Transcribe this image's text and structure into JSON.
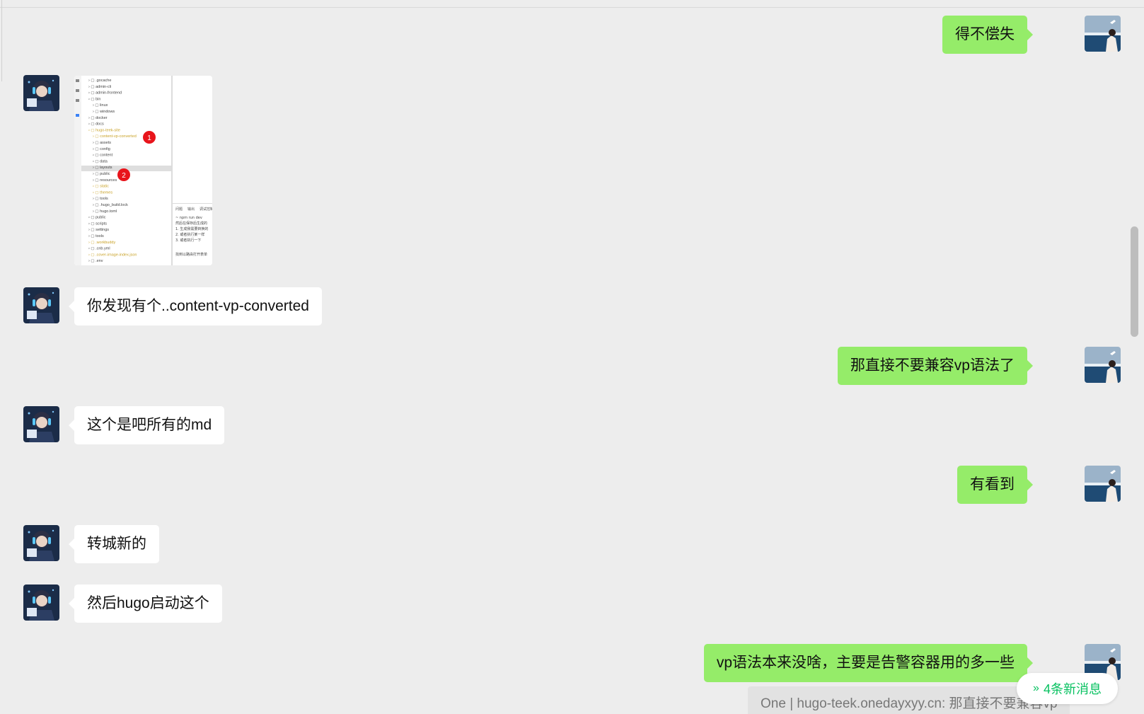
{
  "window": {
    "title": ""
  },
  "messages": [
    {
      "side": "self",
      "text": "得不偿失"
    },
    {
      "side": "other",
      "type": "image",
      "image": {
        "files": [
          ".gocache",
          "admin-cli",
          "admin-frontend",
          "bin",
          "linux",
          "windows",
          "docker",
          "docs",
          "hugo-teek-site",
          "content-vp-converted",
          "assets",
          "config",
          "content",
          "data",
          "layouts",
          "public",
          "resources",
          "static",
          "themes",
          "tools",
          ".hugo_build.lock",
          "hugo.toml",
          "public",
          "scripts",
          "settings",
          "tools",
          ".workbuddy",
          ".cnb.yml",
          ".cover-image-index.json",
          ".env"
        ],
        "panel_tabs": [
          "问题",
          "输出",
          "调试控制台"
        ],
        "panel_lines": [
          "~ npm run dev",
          "然后在保存后生成的",
          "1. 生成我需要转换的",
          "2. 或者执行某一样",
          "3. 或者执行一下",
          "找到以路由打开表单"
        ],
        "badge1": "1",
        "badge2": "2"
      }
    },
    {
      "side": "other",
      "text": "你发现有个..content-vp-converted"
    },
    {
      "side": "self",
      "text": "那直接不要兼容vp语法了"
    },
    {
      "side": "other",
      "text": "这个是吧所有的md"
    },
    {
      "side": "self",
      "text": "有看到"
    },
    {
      "side": "other",
      "text": "转城新的"
    },
    {
      "side": "other",
      "text": "然后hugo启动这个"
    },
    {
      "side": "self",
      "text": "vp语法本来没啥，主要是告警容器用的多一些"
    }
  ],
  "quote": {
    "text": "One | hugo-teek.onedayxyy.cn: 那直接不要兼容vp"
  },
  "new_messages": {
    "label": "4条新消息",
    "icon": "double-chevron-down-icon"
  },
  "colors": {
    "self_bubble": "#95ec69",
    "other_bubble": "#ffffff",
    "background": "#ededed",
    "accent": "#07c160"
  }
}
